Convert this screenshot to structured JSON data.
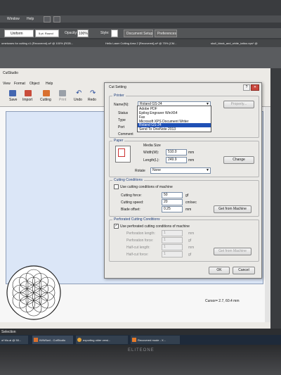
{
  "illustrator": {
    "menu": [
      "Window",
      "Help"
    ],
    "stroke_select": "Uniform",
    "brush_select": "5 pt. Round",
    "opacity_label": "Opacity:",
    "opacity_value": "100%",
    "style_label": "Style:",
    "document_setup": "Document Setup",
    "preferences": "Preferences",
    "tabs": [
      "ometowes for cutting v1 (Recovered).ai* @ 100% (RGB...",
      "Hello Laser Cutting Area 2 [Recovered].ai* @ 75% (CM...",
      "skull_black_and_white_tattoo.eps* @"
    ]
  },
  "cutstudio": {
    "title": "CutStudio",
    "menu": [
      "View",
      "Format",
      "Object",
      "Help"
    ],
    "toolbar": [
      "Save",
      "Import",
      "Cutting",
      "Print",
      "Undo",
      "Redo"
    ],
    "status": "Cursor= 2.7, 60.4 mm"
  },
  "dialog": {
    "title": "Cut Setting",
    "printer_group": "Printer",
    "name_label": "Name(N):",
    "name_value": "Roland GS-24",
    "properties_button": "Property...",
    "status_label": "Status",
    "type_label": "Type",
    "port_label": "Port",
    "comment_label": "Comment",
    "dropdown_options": [
      "Adobe PDF",
      "Epilog Engraver WinX64",
      "Fax",
      "Microsoft XPS Document Writer",
      "Roland GS-24",
      "Send To OneNote 2013"
    ],
    "dropdown_selected": "Roland GS-24",
    "paper_group": "Paper",
    "media_size_label": "Media Size",
    "width_label": "Width(W):",
    "width_value": "510.0",
    "length_label": "Length(L):",
    "length_value": "249.9",
    "mm": "mm",
    "change_button": "Change",
    "rotate_label": "Rotate",
    "rotate_value": "None",
    "cutting_group": "Cutting Conditions",
    "use_machine_cc": "Use cutting conditions of machine",
    "cutting_force_label": "Cutting force:",
    "cutting_force_value": "50",
    "gf": "gf",
    "cutting_speed_label": "Cutting speed:",
    "cutting_speed_value": "20",
    "cm_s": "cm/sec",
    "blade_offset_label": "Blade offset:",
    "blade_offset_value": "0.25",
    "get_from_machine": "Get from Machine",
    "perf_group": "Perforated Cutting Conditions",
    "use_machine_perf": "Use perforated cutting conditions of machine",
    "perf_length_label": "Perforation length:",
    "perf_length_value": "1",
    "perf_force_label": "Perforation force:",
    "perf_force_value": "1",
    "half_cut_length_label": "Half-cut length:",
    "half_cut_length_value": "1",
    "half_cut_force_label": "Half-cut force:",
    "half_cut_force_value": "1",
    "ok_button": "OK",
    "cancel_button": "Cancel"
  },
  "taskbar": {
    "selection": "Selection",
    "items": [
      "of Mu.ai @ 50...",
      "IWW0w4 - CutStudio",
      "exporting older versi...",
      "Recovered mode - X..."
    ]
  },
  "bezel_brand": "ELITEONE"
}
